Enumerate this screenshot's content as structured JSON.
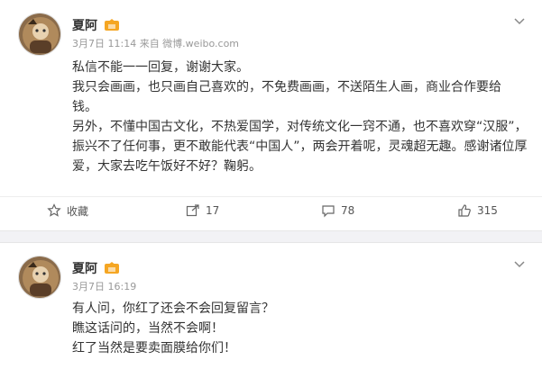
{
  "post1": {
    "author": "夏阿",
    "meta": "3月7日 11:14 来自 微博.weibo.com",
    "lines": [
      "私信不能一一回复，谢谢大家。",
      "我只会画画，也只画自己喜欢的，不免费画画，不送陌生人画，商业合作要给",
      "钱。",
      "另外，不懂中国古文化，不热爱国学，对传统文化一窍不通，也不喜欢穿“汉服”，",
      "振兴不了任何事，更不敢能代表“中国人”，两会开着呢，灵魂超无趣。感谢诸位厚",
      "爱，大家去吃午饭好不好？鞠躬。"
    ],
    "actions": {
      "favorite": "收藏",
      "forward": "17",
      "comment": "78",
      "like": "315"
    }
  },
  "post2": {
    "author": "夏阿",
    "meta": "3月7日 16:19",
    "lines": [
      "有人问，你红了还会不会回复留言？",
      "瞧这话问的，当然不会啊！",
      "红了当然是要卖面膜给你们！"
    ]
  },
  "colors": {
    "text": "#333333",
    "meta": "#999999",
    "divider": "#f2f2f5",
    "badge": "#f5a623"
  }
}
